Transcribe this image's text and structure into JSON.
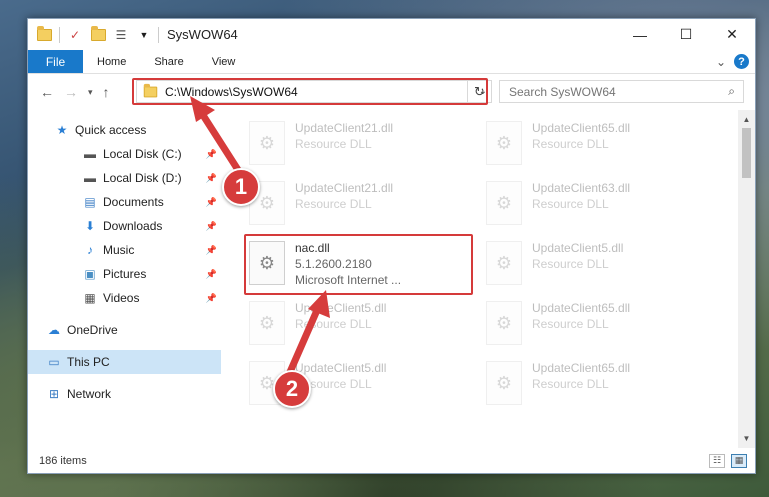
{
  "window": {
    "title": "SysWOW64",
    "controls": {
      "minimize": "—",
      "maximize": "☐",
      "close": "✕"
    }
  },
  "ribbon": {
    "tabs": [
      {
        "label": "File"
      },
      {
        "label": "Home"
      },
      {
        "label": "Share"
      },
      {
        "label": "View"
      }
    ],
    "help": "?",
    "expand": "⌄"
  },
  "address": {
    "path": "C:\\Windows\\SysWOW64",
    "search_placeholder": "Search SysWOW64"
  },
  "nav": {
    "items": [
      {
        "label": "Quick access",
        "icon": "star-icon",
        "glyph": "★",
        "color": "#2a7fd4"
      },
      {
        "label": "Local Disk (C:)",
        "icon": "drive-icon",
        "glyph": "▬",
        "color": "#555",
        "pinned": true
      },
      {
        "label": "Local Disk (D:)",
        "icon": "drive-icon",
        "glyph": "▬",
        "color": "#555",
        "pinned": true
      },
      {
        "label": "Documents",
        "icon": "document-icon",
        "glyph": "▤",
        "color": "#3b7dc4",
        "pinned": true
      },
      {
        "label": "Downloads",
        "icon": "download-icon",
        "glyph": "⬇",
        "color": "#2a7fd4",
        "pinned": true
      },
      {
        "label": "Music",
        "icon": "music-icon",
        "glyph": "♪",
        "color": "#2a7fd4",
        "pinned": true
      },
      {
        "label": "Pictures",
        "icon": "pictures-icon",
        "glyph": "▣",
        "color": "#4a8fc4",
        "pinned": true
      },
      {
        "label": "Videos",
        "icon": "video-icon",
        "glyph": "▦",
        "color": "#555",
        "pinned": true
      },
      {
        "label": "OneDrive",
        "icon": "cloud-icon",
        "glyph": "☁",
        "color": "#2a7fd4"
      },
      {
        "label": "This PC",
        "icon": "computer-icon",
        "glyph": "▭",
        "color": "#3b7dc4",
        "selected": true
      },
      {
        "label": "Network",
        "icon": "network-icon",
        "glyph": "⊞",
        "color": "#3b7dc4"
      }
    ]
  },
  "files": [
    {
      "name": "UpdateClient21.dll",
      "desc": "Resource DLL",
      "faded": true
    },
    {
      "name": "UpdateClient65.dll",
      "desc": "Resource DLL",
      "faded": true
    },
    {
      "name": "UpdateClient21.dll",
      "desc": "Resource DLL",
      "faded": true
    },
    {
      "name": "UpdateClient63.dll",
      "desc": "Resource DLL",
      "faded": true
    },
    {
      "name": "nac.dll",
      "version": "5.1.2600.2180",
      "desc": "Microsoft Internet ...",
      "faded": false
    },
    {
      "name": "UpdateClient5.dll",
      "desc": "Resource DLL",
      "faded": true
    },
    {
      "name": "UpdateClient5.dll",
      "desc": "Resource DLL",
      "faded": true
    },
    {
      "name": "UpdateClient65.dll",
      "desc": "Resource DLL",
      "faded": true
    },
    {
      "name": "UpdateClient5.dll",
      "desc": "Resource DLL",
      "faded": true
    },
    {
      "name": "UpdateClient65.dll",
      "desc": "Resource DLL",
      "faded": true
    }
  ],
  "status": {
    "count": "186 items"
  },
  "annotations": [
    {
      "label": "1"
    },
    {
      "label": "2"
    }
  ],
  "colors": {
    "accent": "#1979ca",
    "highlight": "#d53a3a"
  }
}
